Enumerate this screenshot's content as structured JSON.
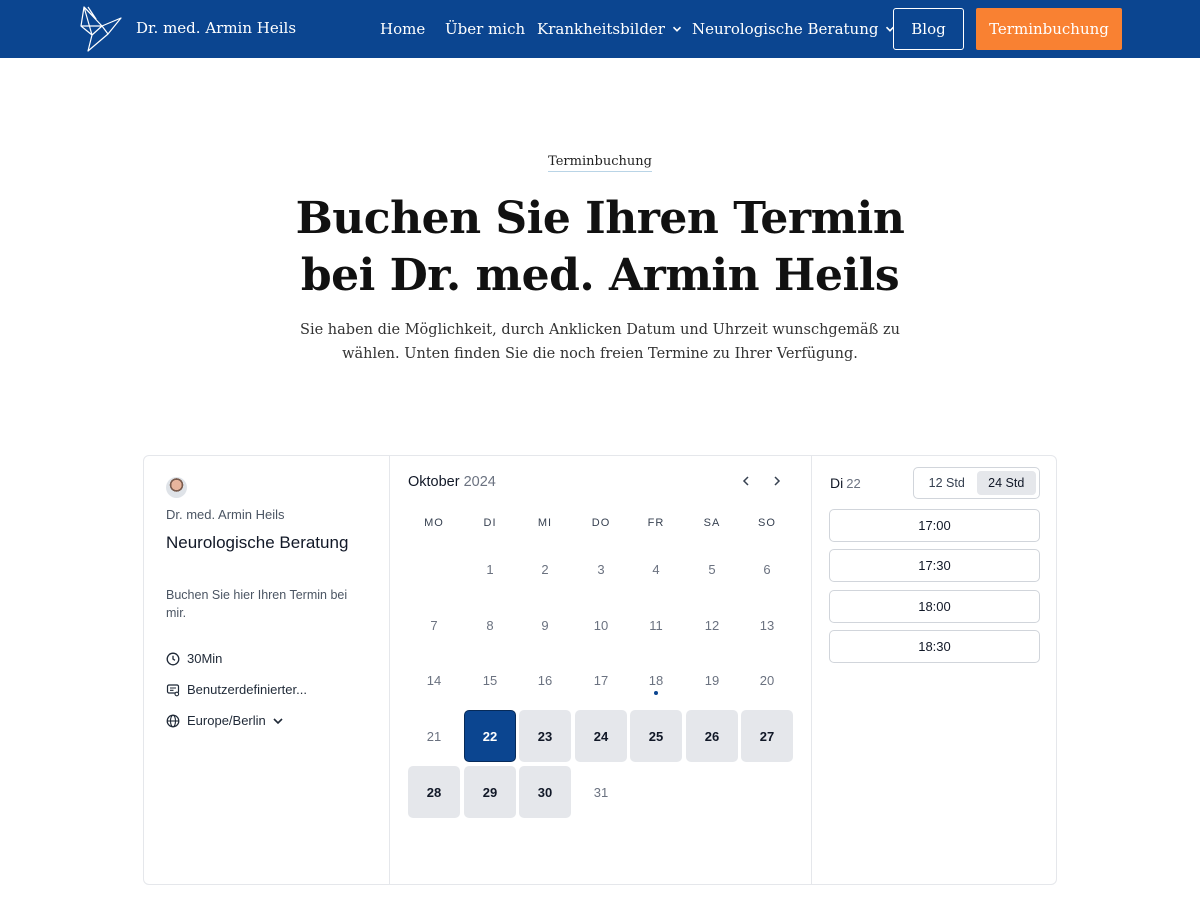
{
  "header": {
    "brand": "Dr. med. Armin Heils",
    "nav": {
      "home": "Home",
      "about": "Über mich",
      "diseases": "Krankheitsbilder",
      "consulting": "Neurologische Beratung"
    },
    "blog_label": "Blog",
    "booking_label": "Terminbuchung",
    "colors": {
      "bar": "#0b4590",
      "cta": "#f98132"
    }
  },
  "hero": {
    "eyebrow": "Terminbuchung",
    "title_line1": "Buchen Sie Ihren Termin",
    "title_line2": "bei Dr. med. Armin Heils",
    "subtitle_line1": "Sie haben die Möglichkeit, durch Anklicken Datum und Uhrzeit wunschgemäß zu",
    "subtitle_line2": "wählen. Unten finden Sie die noch freien Termine zu Ihrer Verfügung."
  },
  "event": {
    "host": "Dr. med. Armin Heils",
    "title": "Neurologische Beratung",
    "description": "Buchen Sie hier Ihren Termin bei mir.",
    "duration": "30Min",
    "location": "Benutzerdefinierter...",
    "timezone": "Europe/Berlin",
    "icons": [
      "clock-icon",
      "location-icon",
      "globe-icon"
    ]
  },
  "calendar": {
    "month": "Oktober",
    "year": "2024",
    "weekdays": [
      "MO",
      "DI",
      "MI",
      "DO",
      "FR",
      "SA",
      "SO"
    ],
    "days": [
      {
        "d": "1",
        "state": "off"
      },
      {
        "d": "2",
        "state": "off"
      },
      {
        "d": "3",
        "state": "off"
      },
      {
        "d": "4",
        "state": "off"
      },
      {
        "d": "5",
        "state": "off"
      },
      {
        "d": "6",
        "state": "off"
      },
      {
        "d": "7",
        "state": "off"
      },
      {
        "d": "8",
        "state": "off"
      },
      {
        "d": "9",
        "state": "off"
      },
      {
        "d": "10",
        "state": "off"
      },
      {
        "d": "11",
        "state": "off"
      },
      {
        "d": "12",
        "state": "off"
      },
      {
        "d": "13",
        "state": "off"
      },
      {
        "d": "14",
        "state": "off"
      },
      {
        "d": "15",
        "state": "off"
      },
      {
        "d": "16",
        "state": "off"
      },
      {
        "d": "17",
        "state": "off"
      },
      {
        "d": "18",
        "state": "today"
      },
      {
        "d": "19",
        "state": "off"
      },
      {
        "d": "20",
        "state": "off"
      },
      {
        "d": "21",
        "state": "off"
      },
      {
        "d": "22",
        "state": "selected"
      },
      {
        "d": "23",
        "state": "avail"
      },
      {
        "d": "24",
        "state": "avail"
      },
      {
        "d": "25",
        "state": "avail"
      },
      {
        "d": "26",
        "state": "avail"
      },
      {
        "d": "27",
        "state": "avail"
      },
      {
        "d": "28",
        "state": "avail"
      },
      {
        "d": "29",
        "state": "avail"
      },
      {
        "d": "30",
        "state": "avail"
      },
      {
        "d": "31",
        "state": "off"
      }
    ],
    "selected_color": "#0b4590"
  },
  "slots": {
    "day_name": "Di",
    "day_num": "22",
    "format_12": "12 Std",
    "format_24": "24 Std",
    "active_format": "24 Std",
    "times": [
      "17:00",
      "17:30",
      "18:00",
      "18:30"
    ]
  }
}
